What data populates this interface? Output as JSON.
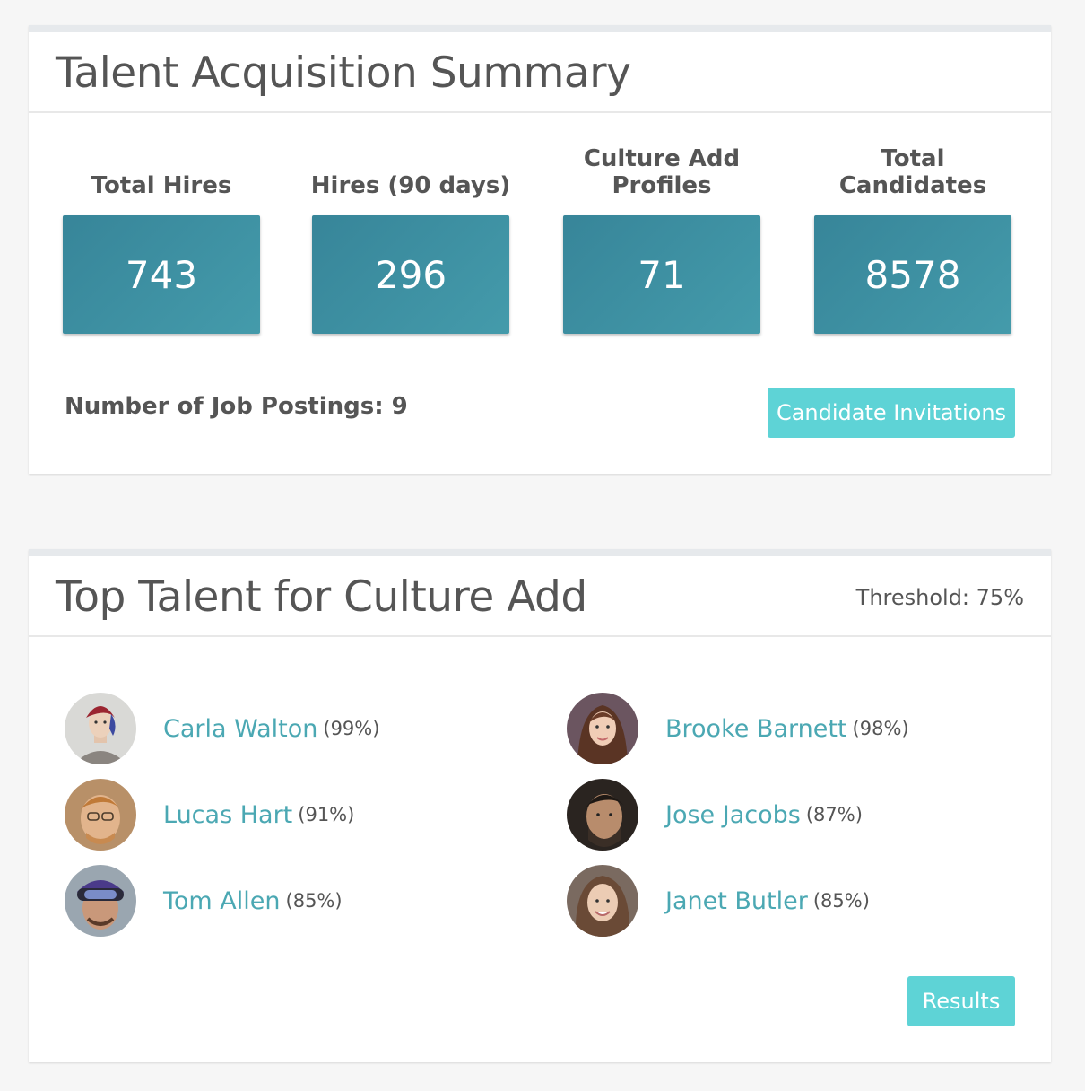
{
  "summary": {
    "title": "Talent Acquisition Summary",
    "stats": [
      {
        "label": "Total Hires",
        "value": "743"
      },
      {
        "label": "Hires (90 days)",
        "value": "296"
      },
      {
        "label": "Culture Add Profiles",
        "value": "71"
      },
      {
        "label": "Total Candidates",
        "value": "8578"
      }
    ],
    "postings_label": "Number of Job Postings: 9",
    "invite_button": "Candidate Invitations"
  },
  "talent": {
    "title": "Top Talent for Culture Add",
    "threshold": "Threshold: 75%",
    "people": [
      {
        "name": "Carla Walton",
        "score": "(99%)"
      },
      {
        "name": "Brooke Barnett",
        "score": "(98%)"
      },
      {
        "name": "Lucas Hart",
        "score": "(91%)"
      },
      {
        "name": "Jose Jacobs",
        "score": "(87%)"
      },
      {
        "name": "Tom Allen",
        "score": "(85%)"
      },
      {
        "name": "Janet Butler",
        "score": "(85%)"
      }
    ],
    "results_button": "Results"
  },
  "colors": {
    "stat_box": "#3b8ea1",
    "button": "#5ed3d6",
    "link": "#4ba8b3"
  }
}
